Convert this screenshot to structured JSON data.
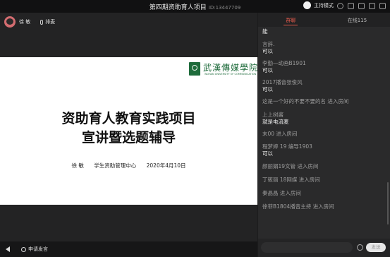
{
  "window": {
    "title": "第四期资助育人项目",
    "room_id": "ID:13447709",
    "host_label": "主持模式"
  },
  "speaker": {
    "name": "徐 敏",
    "mic_label": "排麦"
  },
  "slide": {
    "logo_text": "武漢傳媒學院",
    "logo_sub": "WUHAN UNIVERSITY OF COMMUNICATION",
    "title_line1": "资助育人教育实践项目",
    "title_line2": "宣讲暨选题辅导",
    "presenter": "徐 敏",
    "org": "学生资助管理中心",
    "date": "2020年4月10日"
  },
  "bottom": {
    "apply_label": "申请发言"
  },
  "tabs": [
    {
      "label": "群聊"
    },
    {
      "label": "在线115"
    }
  ],
  "chat": {
    "messages": [
      {
        "user": "",
        "text": "能"
      },
      {
        "user": "言辞.",
        "text": "可以"
      },
      {
        "user": "李勤—动画B1901",
        "text": "可以"
      },
      {
        "user": "2017播音张俊风",
        "text": "可以"
      },
      {
        "user": "这是一个好的不要不要的名 进入房间",
        "text": ""
      },
      {
        "user": "上上树酱",
        "text": "就是电流麦"
      },
      {
        "user": "末00 进入房间",
        "text": ""
      },
      {
        "user": "程梦婷 19 编导1903",
        "text": "可以"
      },
      {
        "user": "颜丽娟19文管 进入房间",
        "text": ""
      },
      {
        "user": "丁筱丽  18网媒 进入房间",
        "text": ""
      },
      {
        "user": "秦晶晶 进入房间",
        "text": ""
      },
      {
        "user": "徐菲B1804播音主持 进入房间",
        "text": ""
      }
    ],
    "send_label": "发送"
  },
  "colors": {
    "accent": "#e05a4c",
    "logo_green": "#1e6b3b"
  }
}
